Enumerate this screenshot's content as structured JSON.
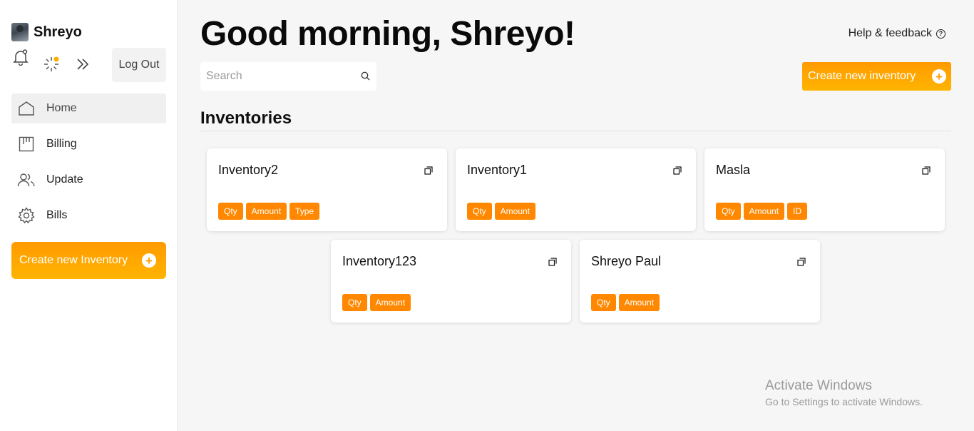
{
  "user": {
    "name": "Shreyo"
  },
  "sidebar": {
    "logout_label": "Log Out",
    "items": [
      {
        "label": "Home",
        "icon": "home-icon",
        "active": true
      },
      {
        "label": "Billing",
        "icon": "billing-icon"
      },
      {
        "label": "Update",
        "icon": "users-icon"
      },
      {
        "label": "Bills",
        "icon": "gear-icon"
      }
    ],
    "create_label": "Create new Inventory"
  },
  "header": {
    "greeting": "Good morning, Shreyo!",
    "help_label": "Help & feedback",
    "search_placeholder": "Search",
    "search_value": "",
    "create_label": "Create new inventory"
  },
  "inventories": {
    "title": "Inventories",
    "cards": [
      {
        "title": "Inventory2",
        "tags": [
          "Qty",
          "Amount",
          "Type"
        ]
      },
      {
        "title": "Inventory1",
        "tags": [
          "Qty",
          "Amount"
        ]
      },
      {
        "title": "Masla",
        "tags": [
          "Qty",
          "Amount",
          "ID"
        ]
      },
      {
        "title": "Inventory123",
        "tags": [
          "Qty",
          "Amount"
        ]
      },
      {
        "title": "Shreyo Paul",
        "tags": [
          "Qty",
          "Amount"
        ]
      }
    ]
  },
  "watermark": {
    "line1": "Activate Windows",
    "line2": "Go to Settings to activate Windows."
  },
  "colors": {
    "accent": "#ff9a00",
    "tag": "#ff8800",
    "notification_dot": "#ffae00"
  }
}
